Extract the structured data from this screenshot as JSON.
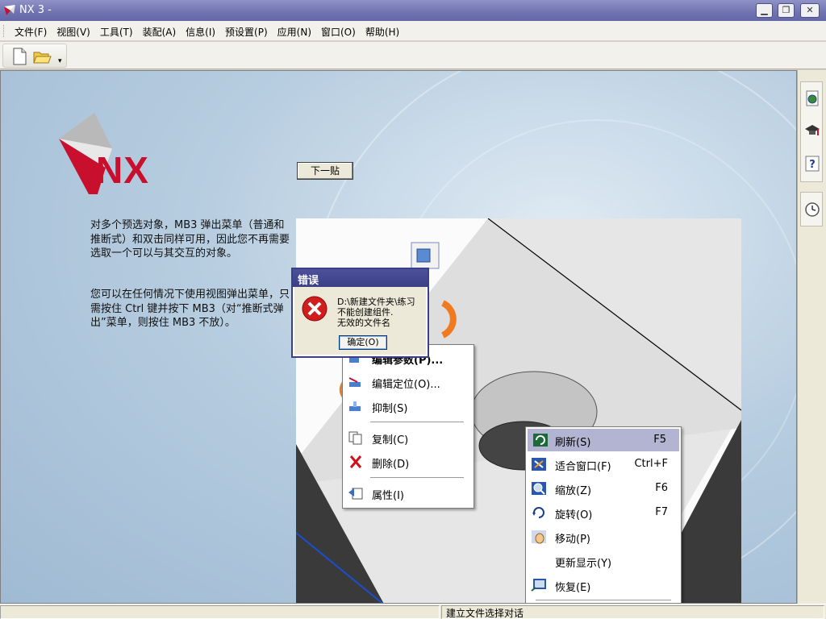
{
  "window": {
    "title": "NX 3 -",
    "min_label": "▁",
    "restore_label": "❐",
    "close_label": "✕"
  },
  "menu": [
    "文件(F)",
    "视图(V)",
    "工具(T)",
    "装配(A)",
    "信息(I)",
    "预设置(P)",
    "应用(N)",
    "窗口(O)",
    "帮助(H)"
  ],
  "toolbar": {
    "new_icon": "new-file-icon",
    "open_icon": "open-folder-icon"
  },
  "logo": {
    "text": "NX"
  },
  "next_button": "下一贴",
  "paragraphs": [
    "对多个预选对象，MB3 弹出菜单（普通和推断式）和双击同样可用，因此您不再需要选取一个可以与其交互的对象。",
    "您可以在任何情况下使用视图弹出菜单，只需按住 Ctrl 键并按下 MB3（对“推断式弹出”菜单，则按住 MB3 不放）。"
  ],
  "context_menu_1": [
    {
      "label": "编辑参数(P)...",
      "icon": "edit-params-icon"
    },
    {
      "label": "编辑定位(O)...",
      "icon": "edit-position-icon"
    },
    {
      "label": "抑制(S)",
      "icon": "suppress-icon"
    },
    {
      "label": "复制(C)",
      "icon": "copy-icon"
    },
    {
      "label": "删除(D)",
      "icon": "delete-icon"
    },
    {
      "label": "属性(I)",
      "icon": "properties-icon"
    }
  ],
  "context_menu_2": [
    {
      "label": "刷新(S)",
      "shortcut": "F5",
      "icon": "refresh-icon"
    },
    {
      "label": "适合窗口(F)",
      "shortcut": "Ctrl+F",
      "icon": "fit-icon"
    },
    {
      "label": "缩放(Z)",
      "shortcut": "F6",
      "icon": "zoom-icon"
    },
    {
      "label": "旋转(O)",
      "shortcut": "F7",
      "icon": "rotate-icon"
    },
    {
      "label": "移动(P)",
      "shortcut": "",
      "icon": "pan-icon"
    },
    {
      "label": "更新显示(Y)",
      "shortcut": "",
      "icon": ""
    },
    {
      "label": "恢复(E)",
      "shortcut": "",
      "icon": "restore-view-icon"
    }
  ],
  "error_dialog": {
    "title": "错误",
    "lines": [
      "D:\\新建文件夹\\练习",
      "不能创建组件.",
      "无效的文件名"
    ],
    "ok_label": "确定(O)"
  },
  "status_text": "建立文件选择对话"
}
